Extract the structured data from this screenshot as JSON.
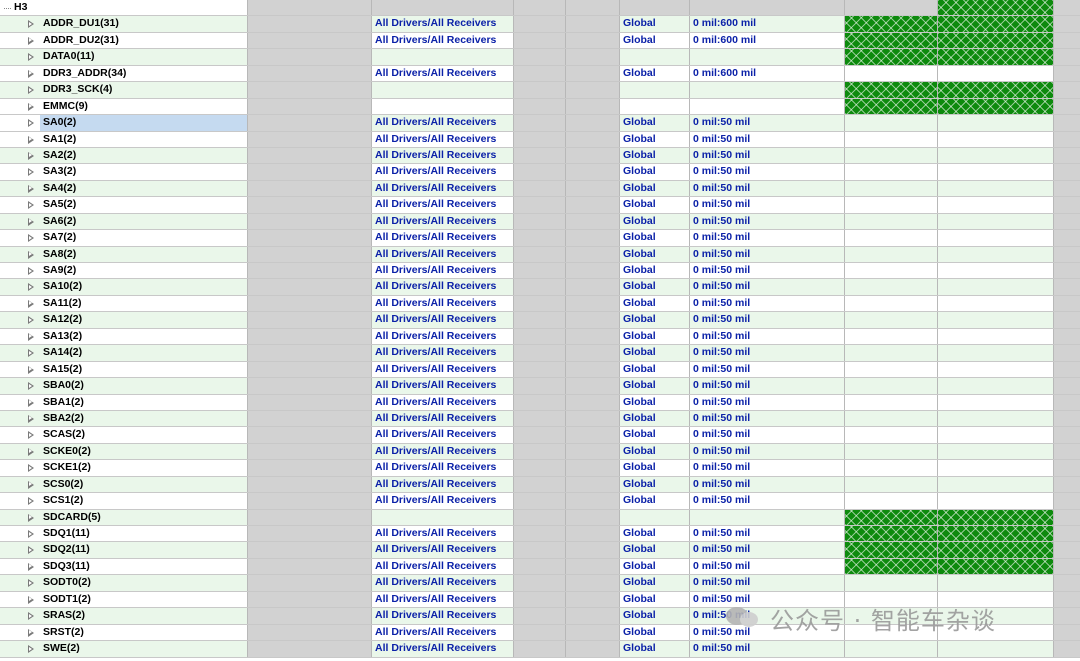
{
  "group": {
    "label": "H3"
  },
  "constraint_columns": {
    "pin_delay": "All Drivers/All Receivers",
    "region": "Global"
  },
  "nets": [
    {
      "name": "ADDR_DU1(31)",
      "pins": "All Drivers/All Receivers",
      "region": "Global",
      "range": "0 mil:600 mil",
      "hatch": "green"
    },
    {
      "name": "ADDR_DU2(31)",
      "pins": "All Drivers/All Receivers",
      "region": "Global",
      "range": "0 mil:600 mil",
      "hatch": "green"
    },
    {
      "name": "DATA0(11)",
      "pins": "",
      "region": "",
      "range": "",
      "hatch": "green"
    },
    {
      "name": "DDR3_ADDR(34)",
      "pins": "All Drivers/All Receivers",
      "region": "Global",
      "range": "0 mil:600 mil",
      "hatch": "light"
    },
    {
      "name": "DDR3_SCK(4)",
      "pins": "",
      "region": "",
      "range": "",
      "hatch": "green"
    },
    {
      "name": "EMMC(9)",
      "pins": "",
      "region": "",
      "range": "",
      "hatch": "green"
    },
    {
      "name": "SA0(2)",
      "pins": "All Drivers/All Receivers",
      "region": "Global",
      "range": "0 mil:50 mil",
      "hatch": "light",
      "selected": true
    },
    {
      "name": "SA1(2)",
      "pins": "All Drivers/All Receivers",
      "region": "Global",
      "range": "0 mil:50 mil",
      "hatch": "light"
    },
    {
      "name": "SA2(2)",
      "pins": "All Drivers/All Receivers",
      "region": "Global",
      "range": "0 mil:50 mil",
      "hatch": "light"
    },
    {
      "name": "SA3(2)",
      "pins": "All Drivers/All Receivers",
      "region": "Global",
      "range": "0 mil:50 mil",
      "hatch": "light"
    },
    {
      "name": "SA4(2)",
      "pins": "All Drivers/All Receivers",
      "region": "Global",
      "range": "0 mil:50 mil",
      "hatch": "light"
    },
    {
      "name": "SA5(2)",
      "pins": "All Drivers/All Receivers",
      "region": "Global",
      "range": "0 mil:50 mil",
      "hatch": "light"
    },
    {
      "name": "SA6(2)",
      "pins": "All Drivers/All Receivers",
      "region": "Global",
      "range": "0 mil:50 mil",
      "hatch": "light"
    },
    {
      "name": "SA7(2)",
      "pins": "All Drivers/All Receivers",
      "region": "Global",
      "range": "0 mil:50 mil",
      "hatch": "light"
    },
    {
      "name": "SA8(2)",
      "pins": "All Drivers/All Receivers",
      "region": "Global",
      "range": "0 mil:50 mil",
      "hatch": "light"
    },
    {
      "name": "SA9(2)",
      "pins": "All Drivers/All Receivers",
      "region": "Global",
      "range": "0 mil:50 mil",
      "hatch": "light"
    },
    {
      "name": "SA10(2)",
      "pins": "All Drivers/All Receivers",
      "region": "Global",
      "range": "0 mil:50 mil",
      "hatch": "light"
    },
    {
      "name": "SA11(2)",
      "pins": "All Drivers/All Receivers",
      "region": "Global",
      "range": "0 mil:50 mil",
      "hatch": "light"
    },
    {
      "name": "SA12(2)",
      "pins": "All Drivers/All Receivers",
      "region": "Global",
      "range": "0 mil:50 mil",
      "hatch": "light"
    },
    {
      "name": "SA13(2)",
      "pins": "All Drivers/All Receivers",
      "region": "Global",
      "range": "0 mil:50 mil",
      "hatch": "light"
    },
    {
      "name": "SA14(2)",
      "pins": "All Drivers/All Receivers",
      "region": "Global",
      "range": "0 mil:50 mil",
      "hatch": "light"
    },
    {
      "name": "SA15(2)",
      "pins": "All Drivers/All Receivers",
      "region": "Global",
      "range": "0 mil:50 mil",
      "hatch": "light"
    },
    {
      "name": "SBA0(2)",
      "pins": "All Drivers/All Receivers",
      "region": "Global",
      "range": "0 mil:50 mil",
      "hatch": "light"
    },
    {
      "name": "SBA1(2)",
      "pins": "All Drivers/All Receivers",
      "region": "Global",
      "range": "0 mil:50 mil",
      "hatch": "light"
    },
    {
      "name": "SBA2(2)",
      "pins": "All Drivers/All Receivers",
      "region": "Global",
      "range": "0 mil:50 mil",
      "hatch": "light"
    },
    {
      "name": "SCAS(2)",
      "pins": "All Drivers/All Receivers",
      "region": "Global",
      "range": "0 mil:50 mil",
      "hatch": "light"
    },
    {
      "name": "SCKE0(2)",
      "pins": "All Drivers/All Receivers",
      "region": "Global",
      "range": "0 mil:50 mil",
      "hatch": "light"
    },
    {
      "name": "SCKE1(2)",
      "pins": "All Drivers/All Receivers",
      "region": "Global",
      "range": "0 mil:50 mil",
      "hatch": "light"
    },
    {
      "name": "SCS0(2)",
      "pins": "All Drivers/All Receivers",
      "region": "Global",
      "range": "0 mil:50 mil",
      "hatch": "light"
    },
    {
      "name": "SCS1(2)",
      "pins": "All Drivers/All Receivers",
      "region": "Global",
      "range": "0 mil:50 mil",
      "hatch": "light"
    },
    {
      "name": "SDCARD(5)",
      "pins": "",
      "region": "",
      "range": "",
      "hatch": "green"
    },
    {
      "name": "SDQ1(11)",
      "pins": "All Drivers/All Receivers",
      "region": "Global",
      "range": "0 mil:50 mil",
      "hatch": "green"
    },
    {
      "name": "SDQ2(11)",
      "pins": "All Drivers/All Receivers",
      "region": "Global",
      "range": "0 mil:50 mil",
      "hatch": "green"
    },
    {
      "name": "SDQ3(11)",
      "pins": "All Drivers/All Receivers",
      "region": "Global",
      "range": "0 mil:50 mil",
      "hatch": "green"
    },
    {
      "name": "SODT0(2)",
      "pins": "All Drivers/All Receivers",
      "region": "Global",
      "range": "0 mil:50 mil",
      "hatch": "light"
    },
    {
      "name": "SODT1(2)",
      "pins": "All Drivers/All Receivers",
      "region": "Global",
      "range": "0 mil:50 mil",
      "hatch": "light"
    },
    {
      "name": "SRAS(2)",
      "pins": "All Drivers/All Receivers",
      "region": "Global",
      "range": "0 mil:50 mil",
      "hatch": "light"
    },
    {
      "name": "SRST(2)",
      "pins": "All Drivers/All Receivers",
      "region": "Global",
      "range": "0 mil:50 mil",
      "hatch": "light"
    },
    {
      "name": "SWE(2)",
      "pins": "All Drivers/All Receivers",
      "region": "Global",
      "range": "0 mil:50 mil",
      "hatch": "light"
    }
  ],
  "watermark": {
    "text": "公众号 · 智能车杂谈"
  }
}
